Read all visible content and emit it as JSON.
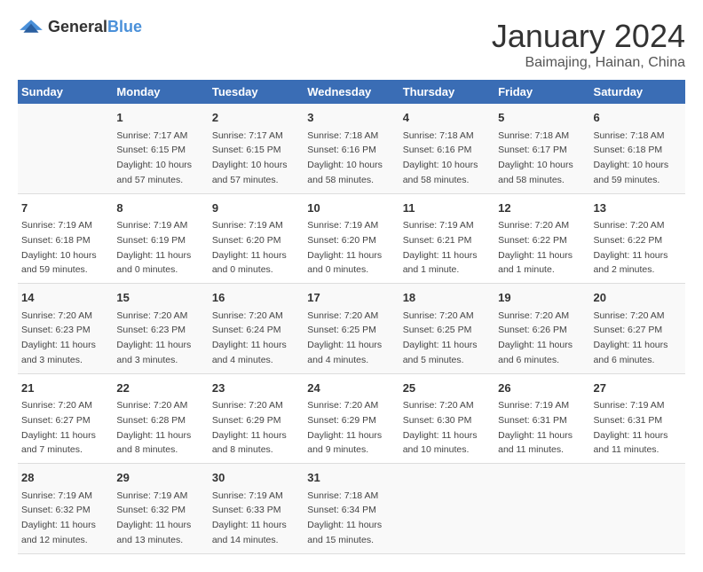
{
  "header": {
    "logo_general": "General",
    "logo_blue": "Blue",
    "title": "January 2024",
    "subtitle": "Baimajing, Hainan, China"
  },
  "days_of_week": [
    "Sunday",
    "Monday",
    "Tuesday",
    "Wednesday",
    "Thursday",
    "Friday",
    "Saturday"
  ],
  "weeks": [
    [
      {
        "day": "",
        "info": ""
      },
      {
        "day": "1",
        "info": "Sunrise: 7:17 AM\nSunset: 6:15 PM\nDaylight: 10 hours\nand 57 minutes."
      },
      {
        "day": "2",
        "info": "Sunrise: 7:17 AM\nSunset: 6:15 PM\nDaylight: 10 hours\nand 57 minutes."
      },
      {
        "day": "3",
        "info": "Sunrise: 7:18 AM\nSunset: 6:16 PM\nDaylight: 10 hours\nand 58 minutes."
      },
      {
        "day": "4",
        "info": "Sunrise: 7:18 AM\nSunset: 6:16 PM\nDaylight: 10 hours\nand 58 minutes."
      },
      {
        "day": "5",
        "info": "Sunrise: 7:18 AM\nSunset: 6:17 PM\nDaylight: 10 hours\nand 58 minutes."
      },
      {
        "day": "6",
        "info": "Sunrise: 7:18 AM\nSunset: 6:18 PM\nDaylight: 10 hours\nand 59 minutes."
      }
    ],
    [
      {
        "day": "7",
        "info": "Sunrise: 7:19 AM\nSunset: 6:18 PM\nDaylight: 10 hours\nand 59 minutes."
      },
      {
        "day": "8",
        "info": "Sunrise: 7:19 AM\nSunset: 6:19 PM\nDaylight: 11 hours\nand 0 minutes."
      },
      {
        "day": "9",
        "info": "Sunrise: 7:19 AM\nSunset: 6:20 PM\nDaylight: 11 hours\nand 0 minutes."
      },
      {
        "day": "10",
        "info": "Sunrise: 7:19 AM\nSunset: 6:20 PM\nDaylight: 11 hours\nand 0 minutes."
      },
      {
        "day": "11",
        "info": "Sunrise: 7:19 AM\nSunset: 6:21 PM\nDaylight: 11 hours\nand 1 minute."
      },
      {
        "day": "12",
        "info": "Sunrise: 7:20 AM\nSunset: 6:22 PM\nDaylight: 11 hours\nand 1 minute."
      },
      {
        "day": "13",
        "info": "Sunrise: 7:20 AM\nSunset: 6:22 PM\nDaylight: 11 hours\nand 2 minutes."
      }
    ],
    [
      {
        "day": "14",
        "info": "Sunrise: 7:20 AM\nSunset: 6:23 PM\nDaylight: 11 hours\nand 3 minutes."
      },
      {
        "day": "15",
        "info": "Sunrise: 7:20 AM\nSunset: 6:23 PM\nDaylight: 11 hours\nand 3 minutes."
      },
      {
        "day": "16",
        "info": "Sunrise: 7:20 AM\nSunset: 6:24 PM\nDaylight: 11 hours\nand 4 minutes."
      },
      {
        "day": "17",
        "info": "Sunrise: 7:20 AM\nSunset: 6:25 PM\nDaylight: 11 hours\nand 4 minutes."
      },
      {
        "day": "18",
        "info": "Sunrise: 7:20 AM\nSunset: 6:25 PM\nDaylight: 11 hours\nand 5 minutes."
      },
      {
        "day": "19",
        "info": "Sunrise: 7:20 AM\nSunset: 6:26 PM\nDaylight: 11 hours\nand 6 minutes."
      },
      {
        "day": "20",
        "info": "Sunrise: 7:20 AM\nSunset: 6:27 PM\nDaylight: 11 hours\nand 6 minutes."
      }
    ],
    [
      {
        "day": "21",
        "info": "Sunrise: 7:20 AM\nSunset: 6:27 PM\nDaylight: 11 hours\nand 7 minutes."
      },
      {
        "day": "22",
        "info": "Sunrise: 7:20 AM\nSunset: 6:28 PM\nDaylight: 11 hours\nand 8 minutes."
      },
      {
        "day": "23",
        "info": "Sunrise: 7:20 AM\nSunset: 6:29 PM\nDaylight: 11 hours\nand 8 minutes."
      },
      {
        "day": "24",
        "info": "Sunrise: 7:20 AM\nSunset: 6:29 PM\nDaylight: 11 hours\nand 9 minutes."
      },
      {
        "day": "25",
        "info": "Sunrise: 7:20 AM\nSunset: 6:30 PM\nDaylight: 11 hours\nand 10 minutes."
      },
      {
        "day": "26",
        "info": "Sunrise: 7:19 AM\nSunset: 6:31 PM\nDaylight: 11 hours\nand 11 minutes."
      },
      {
        "day": "27",
        "info": "Sunrise: 7:19 AM\nSunset: 6:31 PM\nDaylight: 11 hours\nand 11 minutes."
      }
    ],
    [
      {
        "day": "28",
        "info": "Sunrise: 7:19 AM\nSunset: 6:32 PM\nDaylight: 11 hours\nand 12 minutes."
      },
      {
        "day": "29",
        "info": "Sunrise: 7:19 AM\nSunset: 6:32 PM\nDaylight: 11 hours\nand 13 minutes."
      },
      {
        "day": "30",
        "info": "Sunrise: 7:19 AM\nSunset: 6:33 PM\nDaylight: 11 hours\nand 14 minutes."
      },
      {
        "day": "31",
        "info": "Sunrise: 7:18 AM\nSunset: 6:34 PM\nDaylight: 11 hours\nand 15 minutes."
      },
      {
        "day": "",
        "info": ""
      },
      {
        "day": "",
        "info": ""
      },
      {
        "day": "",
        "info": ""
      }
    ]
  ]
}
